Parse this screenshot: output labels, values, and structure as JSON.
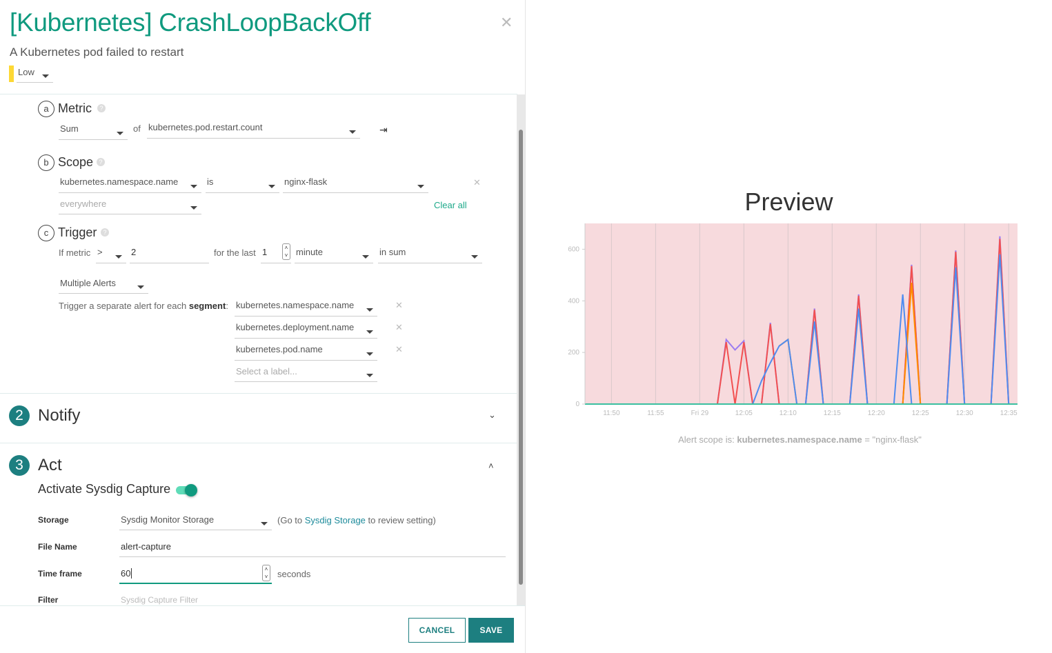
{
  "header": {
    "title": "[Kubernetes] CrashLoopBackOff",
    "subtitle": "A Kubernetes pod failed to restart",
    "severity": "Low",
    "severity_color": "#fdd835"
  },
  "metric": {
    "letter": "a",
    "title": "Metric",
    "aggregation": "Sum",
    "of": "of",
    "metric": "kubernetes.pod.restart.count"
  },
  "scope": {
    "letter": "b",
    "title": "Scope",
    "label": "kubernetes.namespace.name",
    "operator": "is",
    "value": "nginx-flask",
    "add_placeholder": "everywhere",
    "clear_all": "Clear all"
  },
  "trigger": {
    "letter": "c",
    "title": "Trigger",
    "if_metric": "If metric",
    "comparator": ">",
    "threshold": "2",
    "for_the_last": "for the last",
    "duration": "1",
    "unit": "minute",
    "aggregation": "in sum",
    "mode": "Multiple Alerts",
    "segment_text": "Trigger a separate alert for each ",
    "segment_bold": "segment",
    "segment_colon": ":",
    "segments": [
      "kubernetes.namespace.name",
      "kubernetes.deployment.name",
      "kubernetes.pod.name"
    ],
    "segment_placeholder": "Select a label..."
  },
  "notify": {
    "number": "2",
    "title": "Notify"
  },
  "act": {
    "number": "3",
    "title": "Act",
    "capture_label": "Activate Sysdig Capture",
    "capture_enabled": true,
    "storage_label": "Storage",
    "storage_value": "Sysdig Monitor Storage",
    "storage_note_pre": "(Go to ",
    "storage_link": "Sysdig Storage",
    "storage_note_post": " to review setting)",
    "filename_label": "File Name",
    "filename_value": "alert-capture",
    "timeframe_label": "Time frame",
    "timeframe_value": "60",
    "timeframe_unit": "seconds",
    "filter_label": "Filter",
    "filter_placeholder": "Sysdig Capture Filter"
  },
  "footer": {
    "cancel": "CANCEL",
    "save": "SAVE"
  },
  "preview": {
    "title": "Preview",
    "scope_pre": "Alert scope is: ",
    "scope_bold": "kubernetes.namespace.name",
    "scope_post": " = \"nginx-flask\""
  },
  "chart_data": {
    "type": "line",
    "background": "#f7dadd",
    "grid": true,
    "ylim": [
      0,
      700
    ],
    "xlim": [
      "11:47",
      "12:36"
    ],
    "yticks": [
      0,
      200,
      400,
      600
    ],
    "xticks": [
      "11:50",
      "11:55",
      "Fri 29",
      "12:05",
      "12:10",
      "12:15",
      "12:20",
      "12:25",
      "12:30",
      "12:35"
    ],
    "series": [
      {
        "color": "#9b7cf0",
        "points": [
          [
            "12:02",
            0
          ],
          [
            "12:03",
            250
          ],
          [
            "12:04",
            210
          ],
          [
            "12:05",
            245
          ],
          [
            "12:06",
            0
          ],
          [
            "12:07",
            0
          ],
          [
            "12:08",
            315
          ],
          [
            "12:09",
            0
          ],
          [
            "12:12",
            0
          ],
          [
            "12:13",
            370
          ],
          [
            "12:14",
            0
          ],
          [
            "12:17",
            0
          ],
          [
            "12:18",
            425
          ],
          [
            "12:19",
            0
          ],
          [
            "12:23",
            0
          ],
          [
            "12:24",
            540
          ],
          [
            "12:25",
            0
          ],
          [
            "12:28",
            0
          ],
          [
            "12:29",
            595
          ],
          [
            "12:30",
            0
          ],
          [
            "12:33",
            0
          ],
          [
            "12:34",
            650
          ],
          [
            "12:35",
            0
          ]
        ]
      },
      {
        "color": "#f25050",
        "points": [
          [
            "12:02",
            0
          ],
          [
            "12:03",
            240
          ],
          [
            "12:04",
            0
          ],
          [
            "12:05",
            240
          ],
          [
            "12:06",
            0
          ],
          [
            "12:07",
            0
          ],
          [
            "12:08",
            310
          ],
          [
            "12:09",
            0
          ],
          [
            "12:12",
            0
          ],
          [
            "12:13",
            365
          ],
          [
            "12:14",
            0
          ],
          [
            "12:17",
            0
          ],
          [
            "12:18",
            420
          ],
          [
            "12:19",
            0
          ],
          [
            "12:23",
            0
          ],
          [
            "12:24",
            535
          ],
          [
            "12:25",
            0
          ],
          [
            "12:28",
            0
          ],
          [
            "12:29",
            590
          ],
          [
            "12:30",
            0
          ],
          [
            "12:33",
            0
          ],
          [
            "12:34",
            640
          ],
          [
            "12:35",
            0
          ]
        ]
      },
      {
        "color": "#ff8c00",
        "points": [
          [
            "12:09",
            225
          ],
          [
            "12:10",
            250
          ],
          [
            "12:11",
            0
          ],
          [
            "12:23",
            0
          ],
          [
            "12:24",
            470
          ],
          [
            "12:25",
            0
          ]
        ]
      },
      {
        "color": "#4f8cf0",
        "points": [
          [
            "12:06",
            0
          ],
          [
            "12:07",
            90
          ],
          [
            "12:08",
            160
          ],
          [
            "12:09",
            225
          ],
          [
            "12:10",
            250
          ],
          [
            "12:11",
            0
          ],
          [
            "12:12",
            0
          ],
          [
            "12:13",
            320
          ],
          [
            "12:14",
            0
          ],
          [
            "12:17",
            0
          ],
          [
            "12:18",
            370
          ],
          [
            "12:19",
            0
          ],
          [
            "12:22",
            0
          ],
          [
            "12:23",
            425
          ],
          [
            "12:24",
            0
          ],
          [
            "12:28",
            0
          ],
          [
            "12:29",
            530
          ],
          [
            "12:30",
            0
          ],
          [
            "12:33",
            0
          ],
          [
            "12:34",
            580
          ],
          [
            "12:35",
            0
          ]
        ]
      },
      {
        "color": "#3bbfa0",
        "points": [
          [
            "11:47",
            0
          ],
          [
            "12:36",
            0
          ]
        ]
      }
    ]
  }
}
